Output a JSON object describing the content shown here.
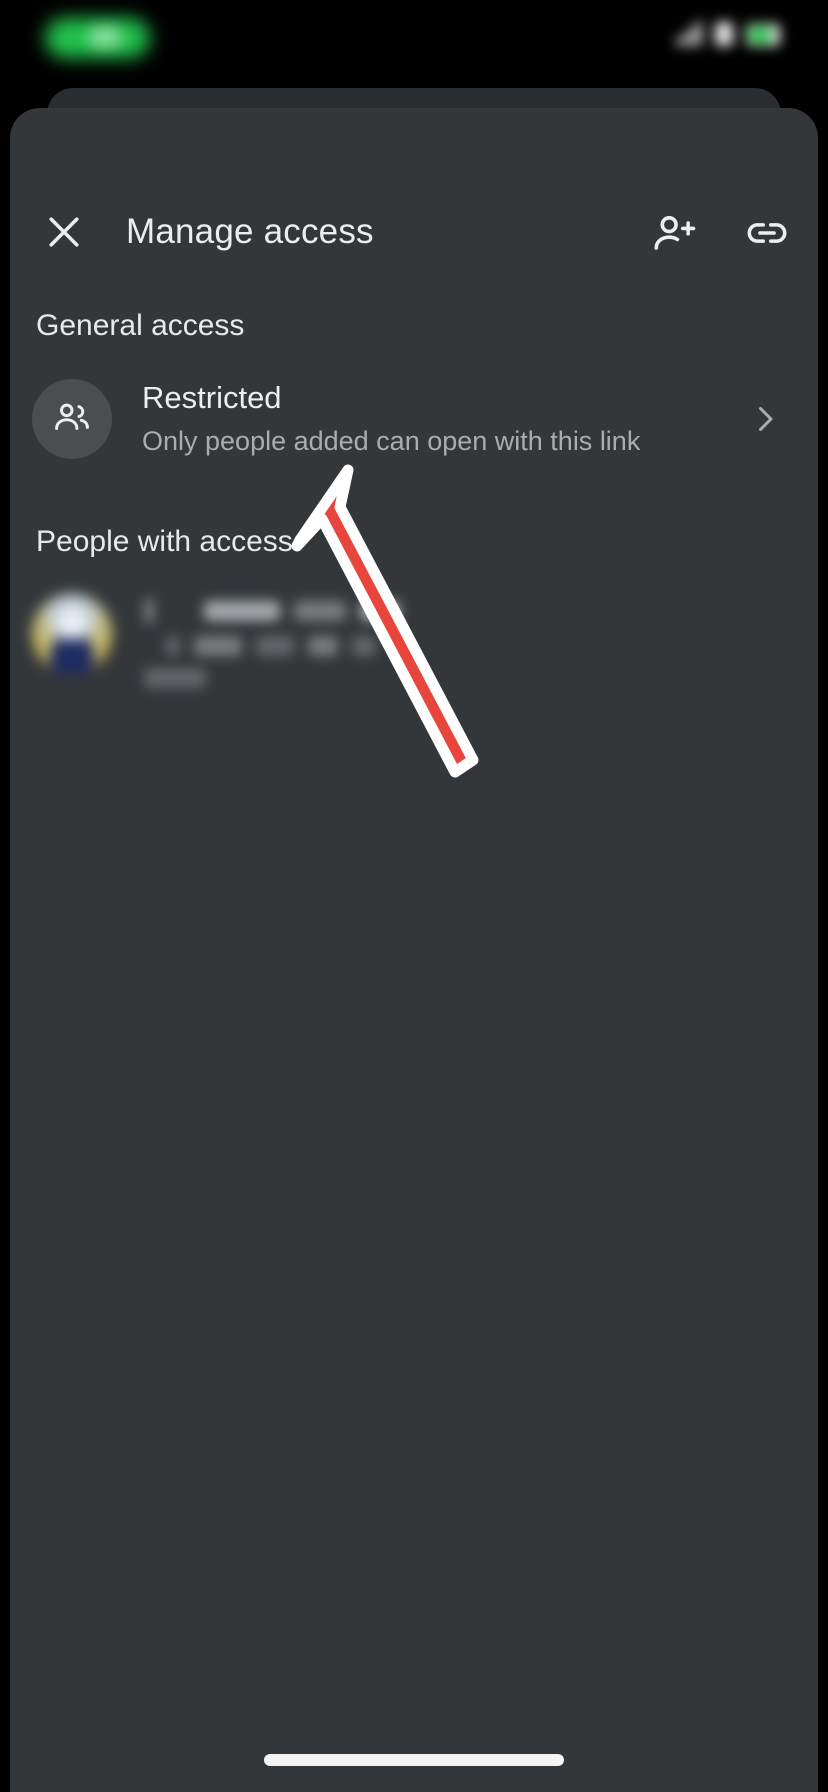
{
  "status_bar": {
    "left_indicator": "recording-pill",
    "icons": [
      "signal-bars",
      "wifi",
      "battery"
    ],
    "battery_color": "#2EC14F"
  },
  "header": {
    "title": "Manage access",
    "close_icon": "close-icon",
    "actions": [
      {
        "name": "add-person-button",
        "icon": "person-add-icon"
      },
      {
        "name": "copy-link-button",
        "icon": "link-icon"
      }
    ]
  },
  "general_access": {
    "section_label": "General access",
    "row": {
      "icon": "people-group-icon",
      "title": "Restricted",
      "subtitle": "Only people added can open with this link",
      "chevron": "chevron-right-icon"
    }
  },
  "people_with_access": {
    "section_label": "People with access",
    "people": [
      {
        "avatar": "user-avatar-photo",
        "name_redacted": true,
        "detail_redacted": true
      }
    ]
  },
  "annotation": {
    "type": "arrow",
    "color": "#E8453C",
    "outline_color": "#FFFFFF",
    "points_to": "Restricted row"
  },
  "system": {
    "home_indicator": "home-indicator",
    "sheet_background": "#33373A",
    "page_background": "#000000"
  }
}
